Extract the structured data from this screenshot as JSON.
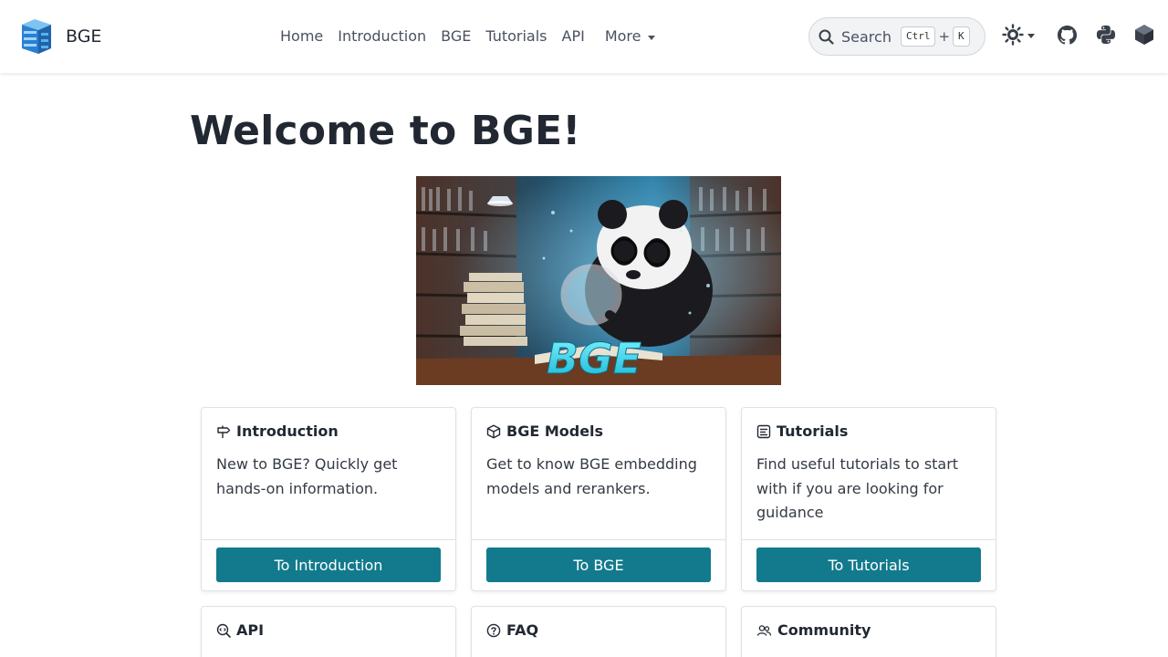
{
  "brand": {
    "name": "BGE"
  },
  "nav": {
    "links": [
      "Home",
      "Introduction",
      "BGE",
      "Tutorials",
      "API"
    ],
    "more_label": "More"
  },
  "search": {
    "label": "Search",
    "shortcut_key1": "Ctrl",
    "shortcut_plus": "+",
    "shortcut_key2": "K"
  },
  "icons": {
    "theme": "theme-switch-icon",
    "github": "github-icon",
    "python": "python-icon",
    "package": "package-icon"
  },
  "page": {
    "title": "Welcome to BGE!"
  },
  "hero_image": {
    "overlay_text": "BGE"
  },
  "cards": [
    {
      "title": "Introduction",
      "text": "New to BGE? Quickly get hands-on information.",
      "button": "To Introduction",
      "icon": "signpost-icon"
    },
    {
      "title": "BGE Models",
      "text": "Get to know BGE embedding models and rerankers.",
      "button": "To BGE",
      "icon": "cube-icon"
    },
    {
      "title": "Tutorials",
      "text": "Find useful tutorials to start with if you are looking for guidance",
      "button": "To Tutorials",
      "icon": "tutorial-icon"
    },
    {
      "title": "API",
      "icon": "search-code-icon"
    },
    {
      "title": "FAQ",
      "icon": "question-icon"
    },
    {
      "title": "Community",
      "icon": "people-icon"
    }
  ],
  "colors": {
    "accent": "#127a8c",
    "text": "#222832",
    "nav_text": "#4a5160"
  }
}
